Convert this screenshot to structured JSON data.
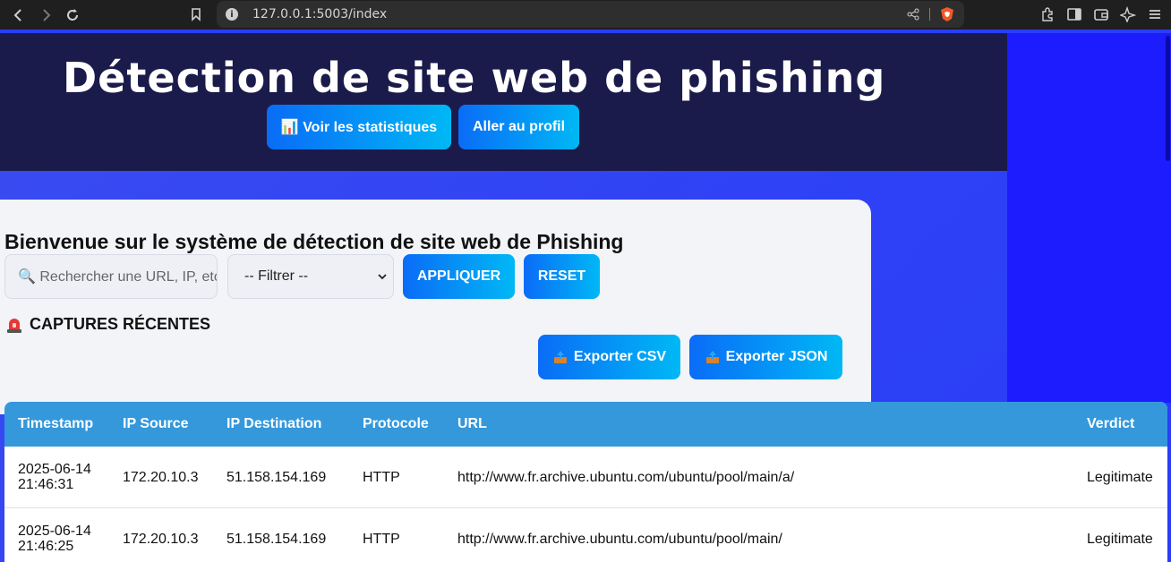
{
  "browser": {
    "url": "127.0.0.1:5003/index"
  },
  "header": {
    "title": "Détection de site web de phishing",
    "stats_button": "📊 Voir les statistiques",
    "profile_button": "Aller au profil"
  },
  "main": {
    "welcome": "Bienvenue sur le système de détection de site web de Phishing",
    "search_placeholder": "🔍 Rechercher une URL, IP, etc",
    "filter_selected": "-- Filtrer --",
    "apply_button": "APPLIQUER",
    "reset_button": "RESET",
    "captures_title": "CAPTURES RÉCENTES",
    "export_csv": "Exporter CSV",
    "export_json": "Exporter JSON"
  },
  "table": {
    "headers": [
      "Timestamp",
      "IP Source",
      "IP Destination",
      "Protocole",
      "URL",
      "Verdict"
    ],
    "rows": [
      {
        "date": "2025-06-14",
        "time": "21:46:31",
        "ip_src": "172.20.10.3",
        "ip_dst": "51.158.154.169",
        "protocol": "HTTP",
        "url": "http://www.fr.archive.ubuntu.com/ubuntu/pool/main/a/",
        "verdict": "Legitimate"
      },
      {
        "date": "2025-06-14",
        "time": "21:46:25",
        "ip_src": "172.20.10.3",
        "ip_dst": "51.158.154.169",
        "protocol": "HTTP",
        "url": "http://www.fr.archive.ubuntu.com/ubuntu/pool/main/",
        "verdict": "Legitimate"
      }
    ]
  },
  "colors": {
    "header_bg": "#1a1b4b",
    "page_bg": "#2a3ef7",
    "table_header": "#3498db",
    "button_start": "#0a6cf7",
    "button_end": "#00b8f5"
  }
}
